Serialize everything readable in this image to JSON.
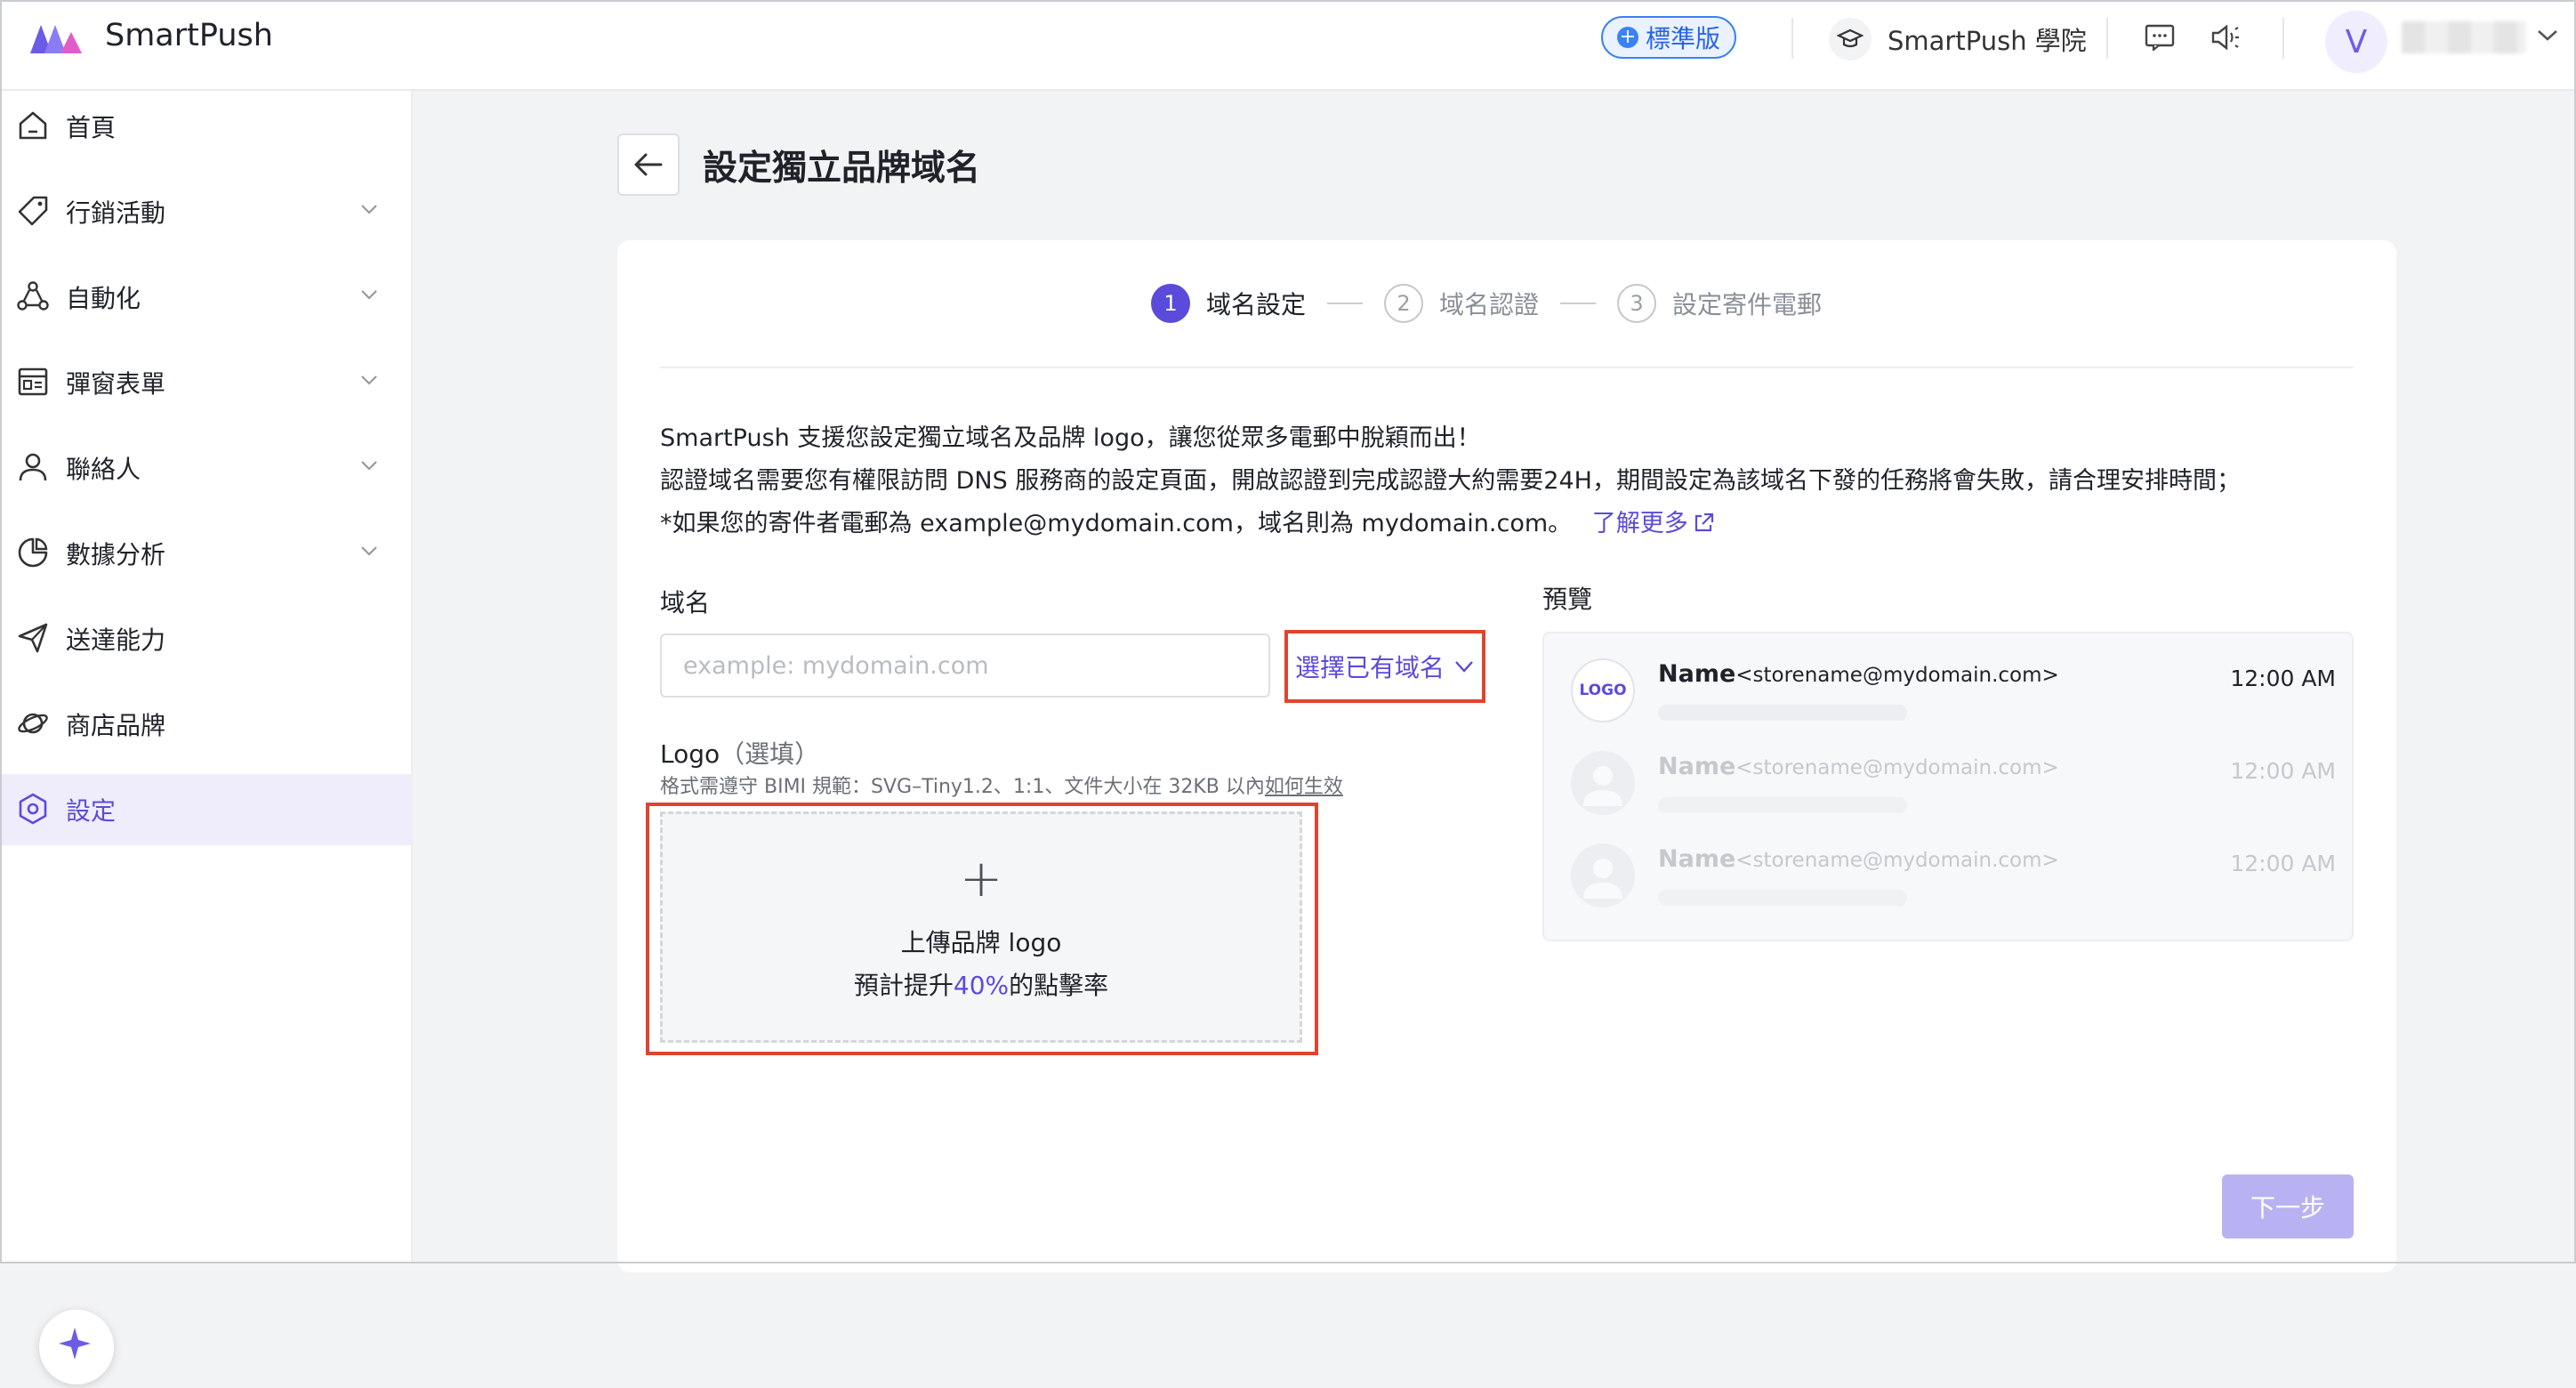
{
  "app": {
    "brand": "SmartPush"
  },
  "header": {
    "plan_badge": "標準版",
    "academy_label": "SmartPush 學院",
    "user_initial": "V"
  },
  "sidebar": {
    "items": [
      {
        "label": "首頁",
        "icon": "home-icon",
        "expandable": false
      },
      {
        "label": "行銷活動",
        "icon": "tag-icon",
        "expandable": true
      },
      {
        "label": "自動化",
        "icon": "automation-icon",
        "expandable": true
      },
      {
        "label": "彈窗表單",
        "icon": "form-icon",
        "expandable": true
      },
      {
        "label": "聯絡人",
        "icon": "person-icon",
        "expandable": true
      },
      {
        "label": "數據分析",
        "icon": "pie-chart-icon",
        "expandable": true
      },
      {
        "label": "送達能力",
        "icon": "send-icon",
        "expandable": false
      },
      {
        "label": "商店品牌",
        "icon": "planet-icon",
        "expandable": false
      },
      {
        "label": "設定",
        "icon": "settings-icon",
        "expandable": false,
        "active": true
      }
    ]
  },
  "page": {
    "title": "設定獨立品牌域名"
  },
  "steps": [
    {
      "num": "1",
      "label": "域名設定",
      "active": true
    },
    {
      "num": "2",
      "label": "域名認證",
      "active": false
    },
    {
      "num": "3",
      "label": "設定寄件電郵",
      "active": false
    }
  ],
  "description": {
    "line1": "SmartPush 支援您設定獨立域名及品牌 logo，讓您從眾多電郵中脫穎而出！",
    "line2": "認證域名需要您有權限訪問 DNS 服務商的設定頁面，開啟認證到完成認證大約需要24H，期間設定為該域名下發的任務將會失敗，請合理安排時間；",
    "line3": "*如果您的寄件者電郵為 example@mydomain.com，域名則為 mydomain.com。",
    "learn_more": "了解更多"
  },
  "form": {
    "domain_label": "域名",
    "domain_placeholder": "example: mydomain.com",
    "domain_value": "",
    "select_existing": "選擇已有域名",
    "logo_label": "Logo",
    "logo_optional": "（選填）",
    "logo_hint": "格式需遵守 BIMI 規範：SVG–Tiny1.2、1:1、文件大小在 32KB 以內",
    "logo_hint_link": "如何生效",
    "upload_title": "上傳品牌 logo",
    "upload_sub_prefix": "預計提升",
    "upload_sub_pct": "40%",
    "upload_sub_suffix": "的點擊率"
  },
  "preview": {
    "label": "預覽",
    "logo_text": "LOGO",
    "rows": [
      {
        "name": "Name",
        "email": "<storename@mydomain.com>",
        "time": "12:00 AM"
      },
      {
        "name": "Name",
        "email": "<storename@mydomain.com>",
        "time": "12:00 AM"
      },
      {
        "name": "Name",
        "email": "<storename@mydomain.com>",
        "time": "12:00 AM"
      }
    ]
  },
  "actions": {
    "next": "下一步"
  },
  "colors": {
    "accent": "#5b4bdb",
    "highlight": "#e0442e",
    "badge": "#3b82f6"
  }
}
